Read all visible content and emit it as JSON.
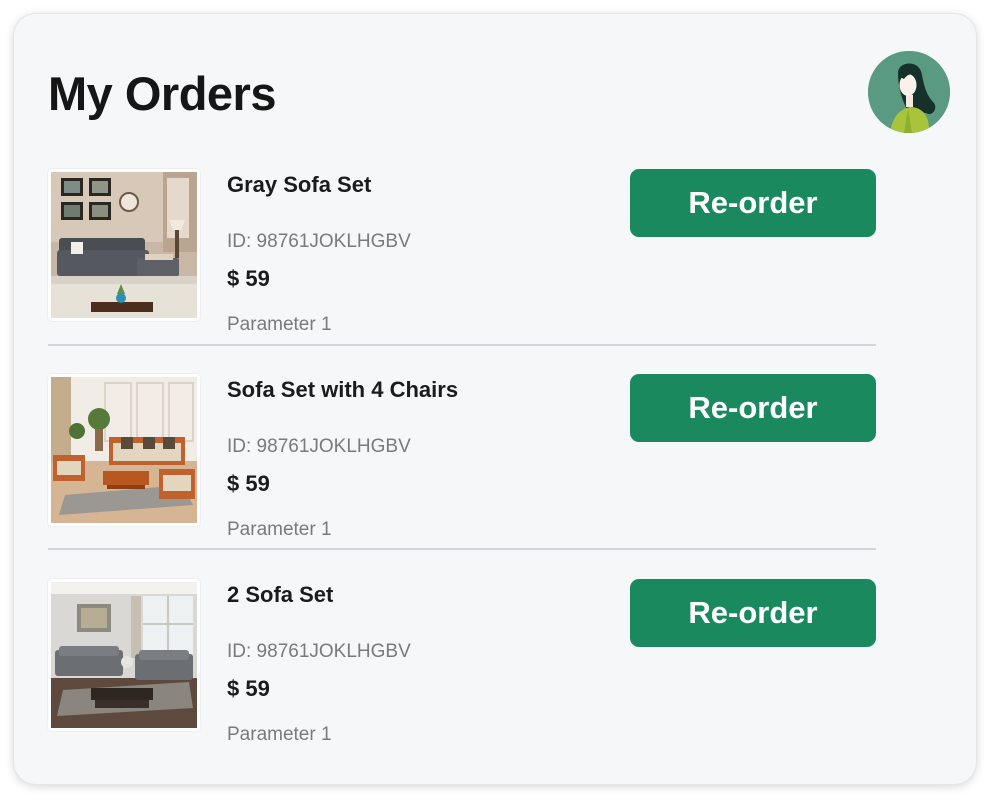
{
  "page": {
    "title": "My Orders"
  },
  "colors": {
    "accent": "#1a8a5e",
    "card_bg": "#f6f7f9",
    "avatar_bg": "#5b9a82"
  },
  "orders": [
    {
      "name": "Gray Sofa Set",
      "id_text": "ID: 98761JOKLHGBV",
      "price": "$ 59",
      "parameter": "Parameter 1",
      "button_label": "Re-order",
      "image": "gray-sofa-living-room-photo"
    },
    {
      "name": "Sofa Set with 4 Chairs",
      "id_text": "ID: 98761JOKLHGBV",
      "price": "$ 59",
      "parameter": "Parameter 1",
      "button_label": "Re-order",
      "image": "wooden-sofa-set-photo"
    },
    {
      "name": "2 Sofa Set",
      "id_text": "ID: 98761JOKLHGBV",
      "price": "$ 59",
      "parameter": "Parameter 1",
      "button_label": "Re-order",
      "image": "gray-two-sofa-set-photo"
    }
  ]
}
